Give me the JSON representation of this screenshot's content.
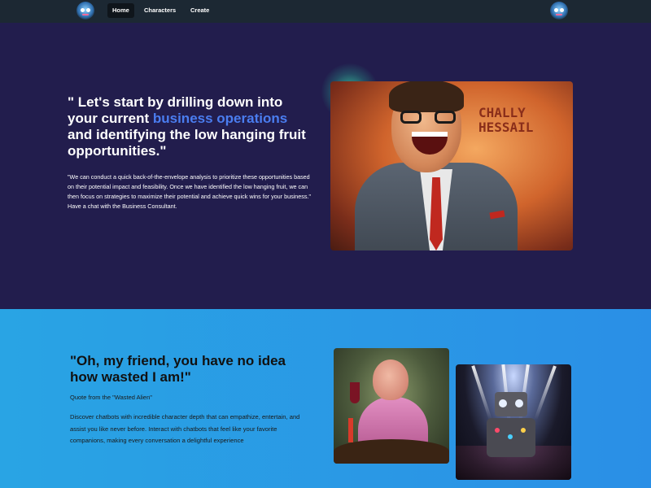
{
  "navbar": {
    "links": {
      "home": "Home",
      "characters": "Characters",
      "create": "Create"
    },
    "logo_icon": "robot-mascot-icon",
    "avatar_icon": "robot-mascot-icon"
  },
  "hero": {
    "title_part1": "\" Let's start by drilling down into your current ",
    "title_highlight": "business operations",
    "title_part2": " and identifying the low hanging fruit opportunities.\"",
    "body": "\"We can conduct a quick back-of-the-envelope analysis to prioritize these opportunities based on their potential impact and feasibility. Once we have identified the low hanging fruit, we can then focus on strategies to maximize their potential and achieve quick wins for your business.\" Have a chat with the Business Consultant.",
    "image_sign_text": "CHALLY\nHESSAIL",
    "highlight_color": "#4a7df0",
    "background_color": "#221d4d"
  },
  "section2": {
    "title": "\"Oh, my friend, you have no idea how wasted I am!\"",
    "quote_source": "Quote from the \"Wasted Alien\"",
    "body": "Discover chatbots with incredible character depth that can empathize, entertain, and assist you like never before. Interact with chatbots that feel like your favorite companions, making every conversation a delightful experience",
    "background_color": "#29a4e4"
  }
}
